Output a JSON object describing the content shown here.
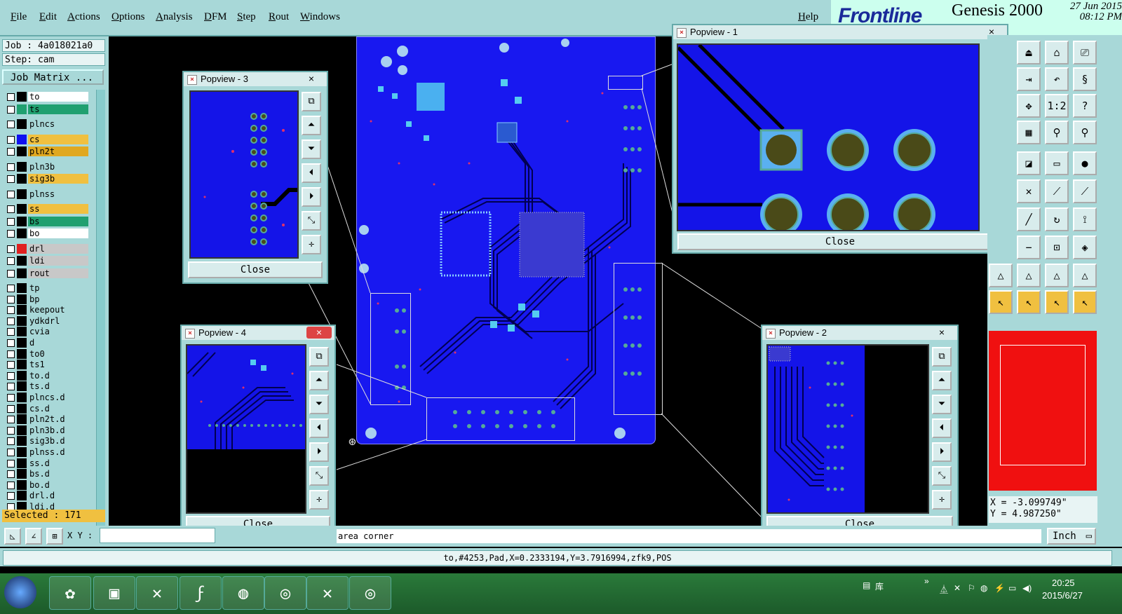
{
  "menu": {
    "items": [
      "File",
      "Edit",
      "Actions",
      "Options",
      "Analysis",
      "DFM",
      "Step",
      "Rout",
      "Windows"
    ],
    "help": "Help"
  },
  "brand": {
    "logo": "Frontline",
    "product": "Genesis 2000",
    "date": "27 Jun 2015",
    "time": "08:12 PM"
  },
  "job": {
    "job_label": "Job : 4a018021a0",
    "step_label": "Step: cam",
    "matrix_button": "Job Matrix ..."
  },
  "layers": [
    {
      "name": "to",
      "bg": "#ffffff",
      "swatch": "#000000"
    },
    {
      "name": "ts",
      "bg": "#20a070",
      "swatch": "#20a070"
    },
    {
      "name": "plncs",
      "bg": "#a8d8d8",
      "swatch": "#000000"
    },
    {
      "name": "cs",
      "bg": "#f0c040",
      "swatch": "#1010f0"
    },
    {
      "name": "pln2t",
      "bg": "#e0a820",
      "swatch": "#000000"
    },
    {
      "name": "pln3b",
      "bg": "#a8d8d8",
      "swatch": "#000000"
    },
    {
      "name": "sig3b",
      "bg": "#f0c040",
      "swatch": "#000000"
    },
    {
      "name": "plnss",
      "bg": "#a8d8d8",
      "swatch": "#000000"
    },
    {
      "name": "ss",
      "bg": "#f0c040",
      "swatch": "#000000"
    },
    {
      "name": "bs",
      "bg": "#20a070",
      "swatch": "#000000"
    },
    {
      "name": "bo",
      "bg": "#ffffff",
      "swatch": "#000000"
    },
    {
      "name": "drl",
      "bg": "#c8c8c8",
      "swatch": "#e02020"
    },
    {
      "name": "ldi",
      "bg": "#c8c8c8",
      "swatch": "#000000"
    },
    {
      "name": "rout",
      "bg": "#c8c8c8",
      "swatch": "#000000"
    },
    {
      "name": "tp",
      "bg": "#a8d8d8",
      "swatch": "#000000"
    },
    {
      "name": "bp",
      "bg": "#a8d8d8",
      "swatch": "#000000"
    },
    {
      "name": "keepout",
      "bg": "#a8d8d8",
      "swatch": "#000000"
    },
    {
      "name": "ydkdrl",
      "bg": "#a8d8d8",
      "swatch": "#000000"
    },
    {
      "name": "cvia",
      "bg": "#a8d8d8",
      "swatch": "#000000"
    },
    {
      "name": "d",
      "bg": "#a8d8d8",
      "swatch": "#000000"
    },
    {
      "name": "to0",
      "bg": "#a8d8d8",
      "swatch": "#000000"
    },
    {
      "name": "ts1",
      "bg": "#a8d8d8",
      "swatch": "#000000"
    },
    {
      "name": "to.d",
      "bg": "#a8d8d8",
      "swatch": "#000000"
    },
    {
      "name": "ts.d",
      "bg": "#a8d8d8",
      "swatch": "#000000"
    },
    {
      "name": "plncs.d",
      "bg": "#a8d8d8",
      "swatch": "#000000"
    },
    {
      "name": "cs.d",
      "bg": "#a8d8d8",
      "swatch": "#000000"
    },
    {
      "name": "pln2t.d",
      "bg": "#a8d8d8",
      "swatch": "#000000"
    },
    {
      "name": "pln3b.d",
      "bg": "#a8d8d8",
      "swatch": "#000000"
    },
    {
      "name": "sig3b.d",
      "bg": "#a8d8d8",
      "swatch": "#000000"
    },
    {
      "name": "plnss.d",
      "bg": "#a8d8d8",
      "swatch": "#000000"
    },
    {
      "name": "ss.d",
      "bg": "#a8d8d8",
      "swatch": "#000000"
    },
    {
      "name": "bs.d",
      "bg": "#a8d8d8",
      "swatch": "#000000"
    },
    {
      "name": "bo.d",
      "bg": "#a8d8d8",
      "swatch": "#000000"
    },
    {
      "name": "drl.d",
      "bg": "#a8d8d8",
      "swatch": "#000000"
    },
    {
      "name": "ldi.d",
      "bg": "#a8d8d8",
      "swatch": "#000000"
    }
  ],
  "selected_label": "Selected : 171",
  "popviews": {
    "p1": {
      "title": "Popview - 1",
      "close": "Close"
    },
    "p2": {
      "title": "Popview - 2",
      "close": "Close"
    },
    "p3": {
      "title": "Popview - 3",
      "close": "Close"
    },
    "p4": {
      "title": "Popview - 4",
      "close": "Close"
    }
  },
  "coords": {
    "x": "X = -3.099749\"",
    "y": "Y = 4.987250\""
  },
  "command": {
    "xy_label": "X Y :",
    "prompt": "area corner",
    "units": "Inch"
  },
  "status_text": "to,#4253,Pad,X=0.2333194,Y=3.7916994,zfk9,POS",
  "taskbar": {
    "tray_label": "库",
    "clock_time": "20:25",
    "clock_date": "2015/6/27"
  },
  "icons": {
    "close": "close-icon",
    "window": "popview-window-icon"
  }
}
